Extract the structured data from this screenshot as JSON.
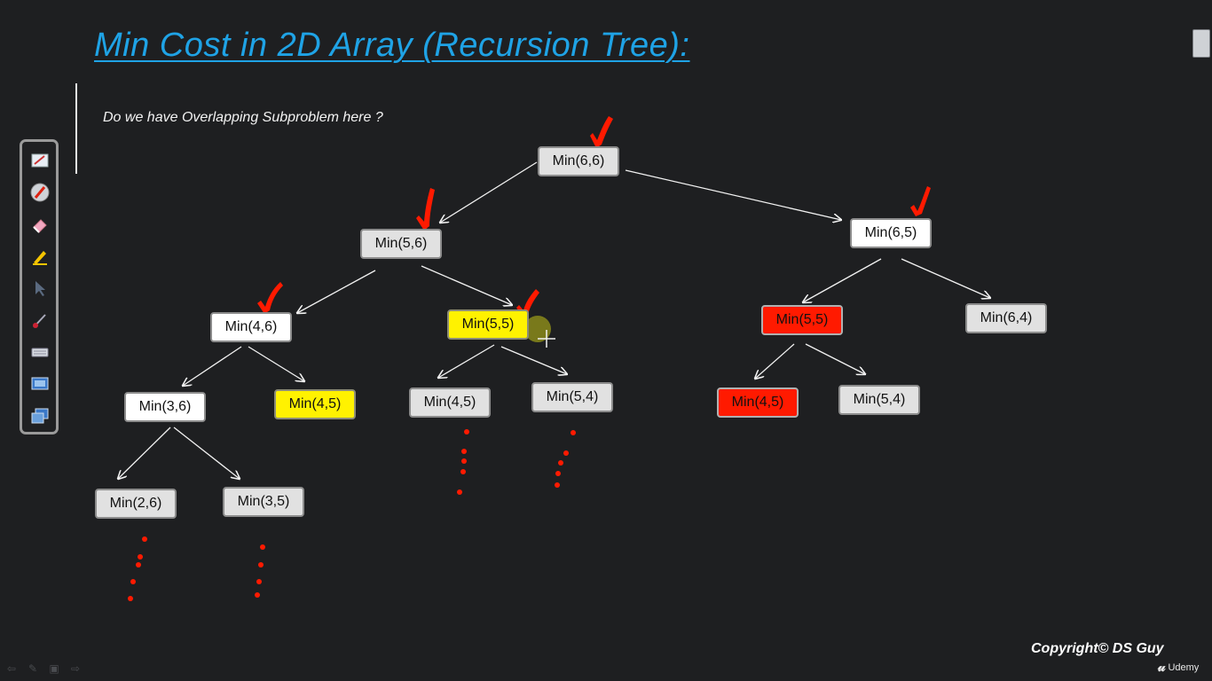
{
  "slide": {
    "title": "Min Cost in 2D Array (Recursion Tree):",
    "question": "Do we have Overlapping Subproblem here ?",
    "copyright": "Copyright© DS Guy",
    "brand": "Udemy",
    "colors": {
      "title": "#1fa3e6",
      "highlight_yellow": "#fff200",
      "highlight_red": "#ff1a00",
      "annotation_red": "#ff1a00",
      "background": "#1e1f21"
    }
  },
  "tree": {
    "nodes": [
      {
        "id": "n66",
        "label": "Min(6,6)",
        "style": "gray"
      },
      {
        "id": "n56",
        "label": "Min(5,6)",
        "style": "gray"
      },
      {
        "id": "n65",
        "label": "Min(6,5)",
        "style": "white"
      },
      {
        "id": "n46",
        "label": "Min(4,6)",
        "style": "white"
      },
      {
        "id": "n55a",
        "label": "Min(5,5)",
        "style": "yellow"
      },
      {
        "id": "n55b",
        "label": "Min(5,5)",
        "style": "red"
      },
      {
        "id": "n64",
        "label": "Min(6,4)",
        "style": "gray"
      },
      {
        "id": "n36",
        "label": "Min(3,6)",
        "style": "white"
      },
      {
        "id": "n45a",
        "label": "Min(4,5)",
        "style": "yellow"
      },
      {
        "id": "n45b",
        "label": "Min(4,5)",
        "style": "gray"
      },
      {
        "id": "n54a",
        "label": "Min(5,4)",
        "style": "gray"
      },
      {
        "id": "n45c",
        "label": "Min(4,5)",
        "style": "red"
      },
      {
        "id": "n54b",
        "label": "Min(5,4)",
        "style": "gray"
      },
      {
        "id": "n26",
        "label": "Min(2,6)",
        "style": "gray"
      },
      {
        "id": "n35",
        "label": "Min(3,5)",
        "style": "gray"
      }
    ]
  },
  "toolbar": {
    "tools": [
      {
        "name": "whiteboard-icon"
      },
      {
        "name": "pen-color-icon"
      },
      {
        "name": "eraser-icon"
      },
      {
        "name": "highlighter-icon"
      },
      {
        "name": "pointer-icon"
      },
      {
        "name": "brush-icon"
      },
      {
        "name": "keyboard-icon"
      },
      {
        "name": "screen-capture-icon"
      },
      {
        "name": "window-switch-icon"
      }
    ]
  },
  "navigation": {
    "icons": [
      "back-arrow-icon",
      "pen-icon",
      "slides-icon",
      "forward-arrow-icon"
    ]
  }
}
